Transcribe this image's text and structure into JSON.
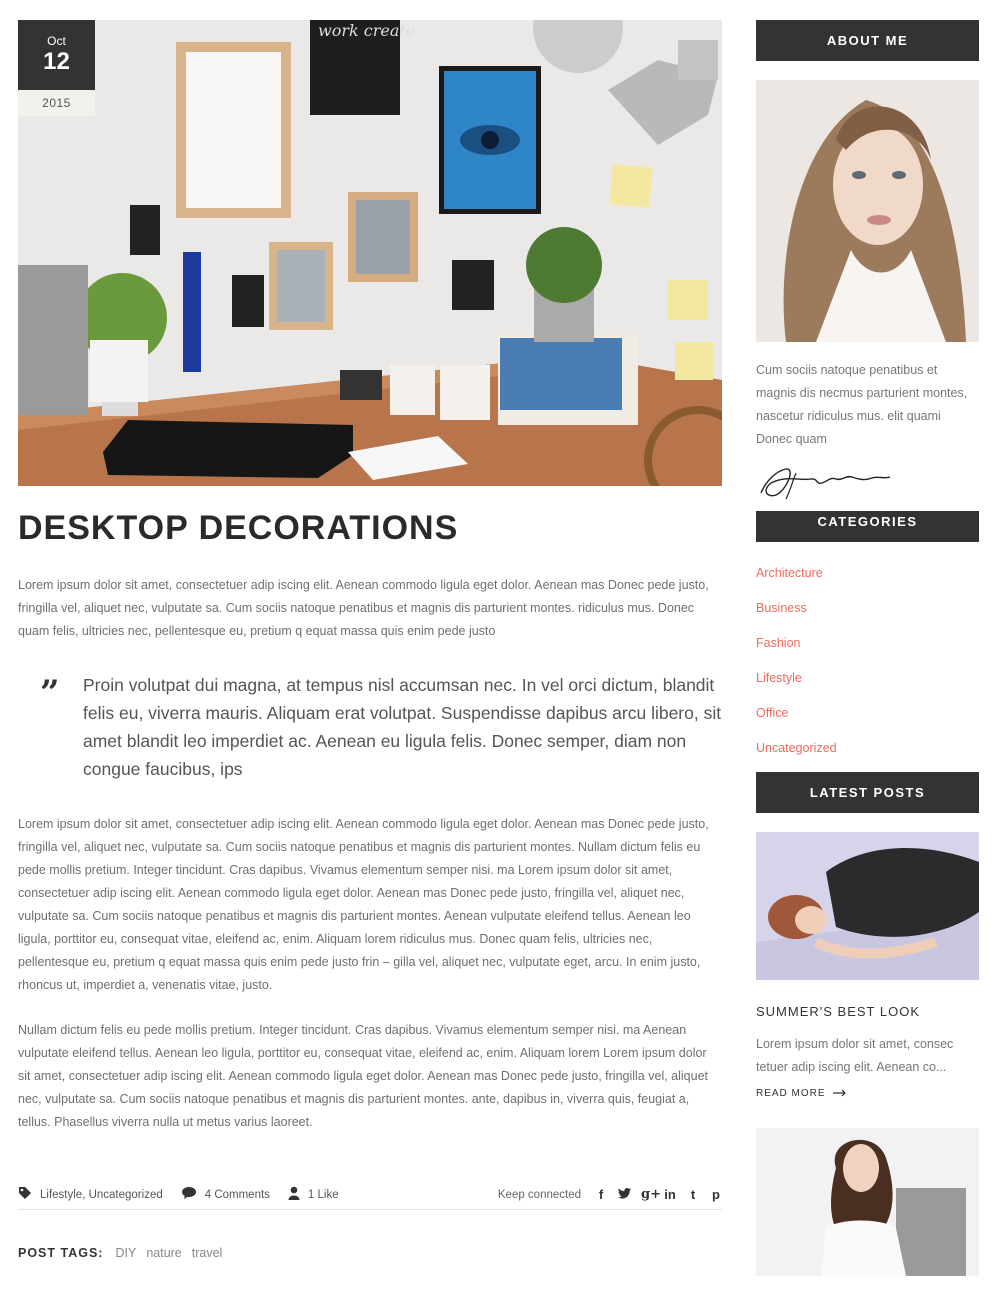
{
  "post": {
    "date": {
      "month": "Oct",
      "day": "12",
      "year": "2015"
    },
    "title": "DESKTOP DECORATIONS",
    "hero_image_text": "work create",
    "paragraph1": "Lorem ipsum dolor sit amet, consectetuer adip iscing elit. Aenean commodo ligula eget dolor. Aenean mas Donec pede justo, fringilla vel, aliquet nec, vulputate sa. Cum sociis natoque penatibus et magnis dis parturient montes. ridiculus mus. Donec quam felis, ultricies nec, pellentesque eu, pretium q equat massa quis enim pede justo",
    "quote_mark": "”",
    "quote": "Proin volutpat dui magna, at tempus nisl accumsan nec. In vel orci dictum, blandit felis eu, viverra mauris. Aliquam erat volutpat. Suspendisse dapibus arcu libero, sit amet blandit leo imperdiet ac. Aenean eu ligula felis. Donec semper, diam non congue faucibus, ips",
    "paragraph2": "Lorem ipsum dolor sit amet, consectetuer adip iscing elit. Aenean commodo ligula eget dolor. Aenean mas Donec pede justo, fringilla vel, aliquet nec, vulputate sa. Cum sociis natoque penatibus et magnis dis parturient montes. Nullam dictum felis eu pede mollis pretium. Integer tincidunt. Cras dapibus. Vivamus elementum semper nisi. ma Lorem ipsum dolor sit amet, consectetuer adip iscing elit. Aenean commodo ligula eget dolor. Aenean mas Donec pede justo, fringilla vel, aliquet nec, vulputate sa. Cum sociis natoque penatibus et magnis dis parturient montes. Aenean vulputate eleifend tellus. Aenean leo ligula, porttitor eu, consequat vitae, eleifend ac, enim. Aliquam lorem ridiculus mus. Donec quam felis, ultricies nec, pellentesque eu, pretium q equat massa quis enim pede justo frin – gilla vel, aliquet nec, vulputate eget, arcu. In enim justo, rhoncus ut, imperdiet a, venenatis vitae, justo.",
    "paragraph3": "Nullam dictum felis eu pede mollis pretium. Integer tincidunt. Cras dapibus. Vivamus elementum semper nisi. ma Aenean vulputate eleifend tellus. Aenean leo ligula, porttitor eu, consequat vitae, eleifend ac, enim. Aliquam lorem Lorem ipsum dolor sit amet, consectetuer adip iscing elit. Aenean commodo ligula eget dolor. Aenean mas Donec pede justo, fringilla vel, aliquet nec, vulputate sa. Cum sociis natoque penatibus et magnis dis parturient montes. ante, dapibus in, viverra quis, feugiat a, tellus. Phasellus viverra nulla ut metus varius laoreet.",
    "meta": {
      "category_1": "Lifestyle",
      "category_2": "Uncategorized",
      "comments": "4 Comments",
      "likes": "1 Like",
      "keep_connected": "Keep connected",
      "icons": [
        "tag-icon",
        "comment-icon",
        "user-icon"
      ],
      "social": [
        {
          "name": "facebook-icon",
          "glyph": "f"
        },
        {
          "name": "twitter-icon",
          "glyph": "🐦"
        },
        {
          "name": "google-plus-icon",
          "glyph": "g+"
        },
        {
          "name": "linkedin-icon",
          "glyph": "in"
        },
        {
          "name": "tumblr-icon",
          "glyph": "t"
        },
        {
          "name": "pinterest-icon",
          "glyph": "p"
        }
      ]
    },
    "tags": {
      "label": "POST TAGS:",
      "items": [
        "DIY",
        "nature",
        "travel"
      ]
    }
  },
  "sidebar": {
    "about": {
      "title": "ABOUT ME",
      "text": "Cum sociis natoque penatibus et magnis dis necmus parturient montes, nascetur ridiculus mus. elit quami Donec quam"
    },
    "categories": {
      "title": "CATEGORIES",
      "items": [
        "Architecture",
        "Business",
        "Fashion",
        "Lifestyle",
        "Office",
        "Uncategorized"
      ]
    },
    "latest": {
      "title": "LATEST POSTS",
      "post_title": "SUMMER'S BEST LOOK",
      "post_excerpt": "Lorem ipsum dolor sit amet, consec tetuer adip iscing elit. Aenean co...",
      "read_more": "READ MORE"
    }
  },
  "colors": {
    "dark": "#333333",
    "accent": "#ef6b5f",
    "text": "#777777"
  }
}
